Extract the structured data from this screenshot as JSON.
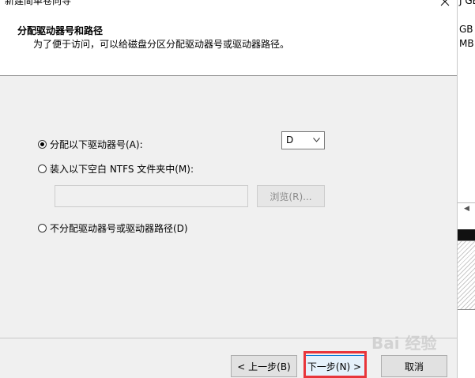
{
  "window": {
    "title": "新建简单卷向导",
    "close_icon": "close-icon"
  },
  "header": {
    "title": "分配驱动器号和路径",
    "description": "为了便于访问，可以给磁盘分区分配驱动器号或驱动器路径。"
  },
  "options": {
    "assign_letter": {
      "label": "分配以下驱动器号(A):",
      "selected": true
    },
    "mount_folder": {
      "label": "装入以下空白 NTFS 文件夹中(M):",
      "selected": false
    },
    "no_assign": {
      "label": "不分配驱动器号或驱动器路径(D)",
      "selected": false
    }
  },
  "drive_letter": {
    "value": "D"
  },
  "folder_path": {
    "value": "",
    "browse_label": "浏览(R)..."
  },
  "buttons": {
    "back": "< 上一步(B)",
    "next": "下一步(N) >",
    "cancel": "取消"
  },
  "background_window": {
    "lines": [
      "J GB",
      "GB",
      "MB"
    ]
  },
  "watermark": "Bai 经验",
  "colors": {
    "highlight": "#e8353b",
    "default_button_border": "#0078d7"
  }
}
